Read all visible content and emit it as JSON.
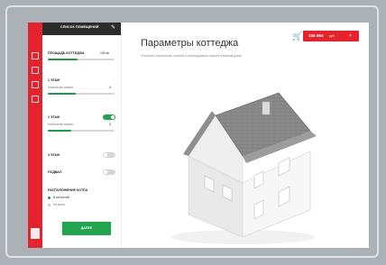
{
  "panel": {
    "title": "СПИСОК ПОМЕЩЕНИЙ",
    "area_label": "ПЛОЩАДЬ КОТТЕДЖА",
    "area_value": "100 м²",
    "area_progress": 0.45,
    "floor1": {
      "title": "1 ЭТАЖ",
      "rooms_label": "Количество комнат",
      "rooms_value": "4",
      "progress": 0.42
    },
    "floor2": {
      "title": "2 ЭТАЖ",
      "enabled": true,
      "rooms_label": "Количество комнат",
      "rooms_value": "3",
      "progress": 0.35
    },
    "floor3": {
      "title": "3 ЭТАЖ",
      "enabled": false
    },
    "basement": {
      "title": "ПОДВАЛ",
      "enabled": false
    },
    "boiler": {
      "title": "РАСПОЛОЖЕНИЕ КОТЛА",
      "options": [
        "В котельной",
        "На кухне"
      ],
      "selected": 0
    },
    "next_button": "ДАЛЕЕ"
  },
  "header": {
    "title": "Параметры коттеджа",
    "subtitle": "Уточните количество этажей и планируемых комнат в вашем доме",
    "price": "165 864",
    "currency": "руб",
    "accent": "#e5232e",
    "green": "#22a450"
  }
}
